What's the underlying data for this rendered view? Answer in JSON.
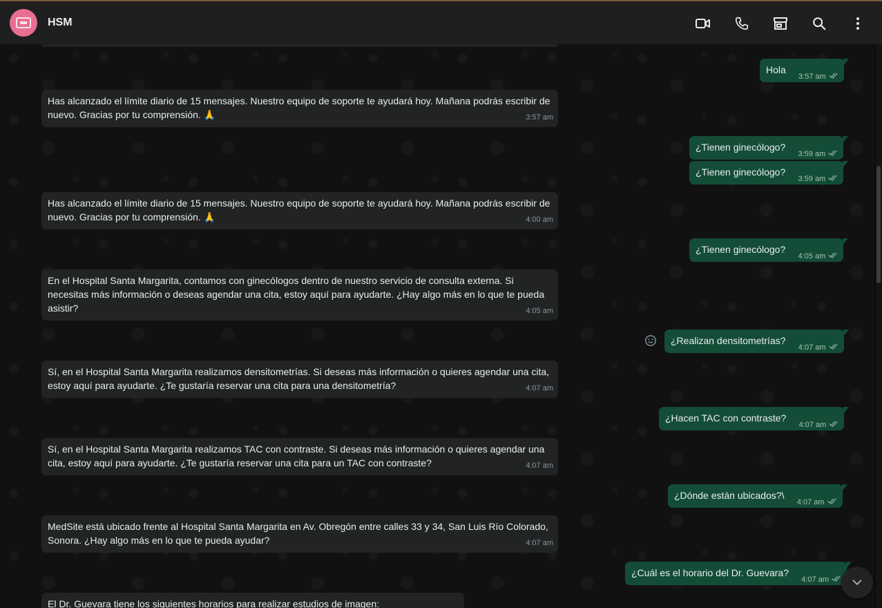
{
  "header": {
    "title": "HSM",
    "icons": [
      "video-call-icon",
      "voice-call-icon",
      "catalog-store-icon",
      "search-icon",
      "menu-icon"
    ]
  },
  "colors": {
    "outgoing_bubble": "#144d37",
    "incoming_bubble": "#222424",
    "avatar": "#e86f92"
  },
  "messages": [
    {
      "dir": "out",
      "text": "Hola",
      "time": "3:57 am"
    },
    {
      "dir": "in",
      "text": "Has alcanzado el límite diario de 15 mensajes. Nuestro equipo de soporte te ayudará hoy. Mañana podrás escribir de nuevo. Gracias por tu comprensión. 🙏",
      "time": "3:57 am"
    },
    {
      "dir": "out",
      "text": "¿Tienen ginecólogo?",
      "time": "3:59 am"
    },
    {
      "dir": "out",
      "text": "¿Tienen ginecólogo?",
      "time": "3:59 am"
    },
    {
      "dir": "in",
      "text": "Has alcanzado el límite diario de 15 mensajes. Nuestro equipo de soporte te ayudará hoy. Mañana podrás escribir de nuevo. Gracias por tu comprensión. 🙏",
      "time": "4:00 am"
    },
    {
      "dir": "out",
      "text": "¿Tienen ginecólogo?",
      "time": "4:05 am"
    },
    {
      "dir": "in",
      "text": "En el Hospital Santa Margarita, contamos con ginecólogos dentro de nuestro servicio de consulta externa. Si necesitas más información o deseas agendar una cita, estoy aquí para ayudarte. ¿Hay algo más en lo que te pueda asistir?",
      "time": "4:05 am"
    },
    {
      "dir": "out",
      "text": "¿Realizan densitometrías?",
      "time": "4:07 am"
    },
    {
      "dir": "in",
      "text": "Sí, en el Hospital Santa Margarita realizamos densitometrías. Si deseas más información o quieres agendar una cita, estoy aquí para ayudarte. ¿Te gustaría reservar una cita para una densitometría?",
      "time": "4:07 am"
    },
    {
      "dir": "out",
      "text": "¿Hacen TAC con contraste?",
      "time": "4:07 am"
    },
    {
      "dir": "in",
      "text": "Sí, en el Hospital Santa Margarita realizamos TAC con contraste. Si deseas más información o quieres agendar una cita, estoy aquí para ayudarte. ¿Te gustaría reservar una cita para un TAC con contraste?",
      "time": "4:07 am"
    },
    {
      "dir": "out",
      "text": "¿Dónde están ubicados?\\",
      "time": "4:07 am"
    },
    {
      "dir": "in",
      "text": "MedSite está ubicado frente al Hospital Santa Margarita en Av. Obregón entre calles 33 y 34, San Luis Río Colorado, Sonora. ¿Hay algo más en lo que te pueda ayudar?",
      "time": "4:07 am"
    },
    {
      "dir": "out",
      "text": "¿Cuál es el horario del Dr. Guevara?",
      "time": "4:07 am"
    },
    {
      "dir": "in",
      "text": "El Dr. Guevara tiene los siguientes horarios para realizar estudios de imagen:",
      "time": ""
    }
  ]
}
